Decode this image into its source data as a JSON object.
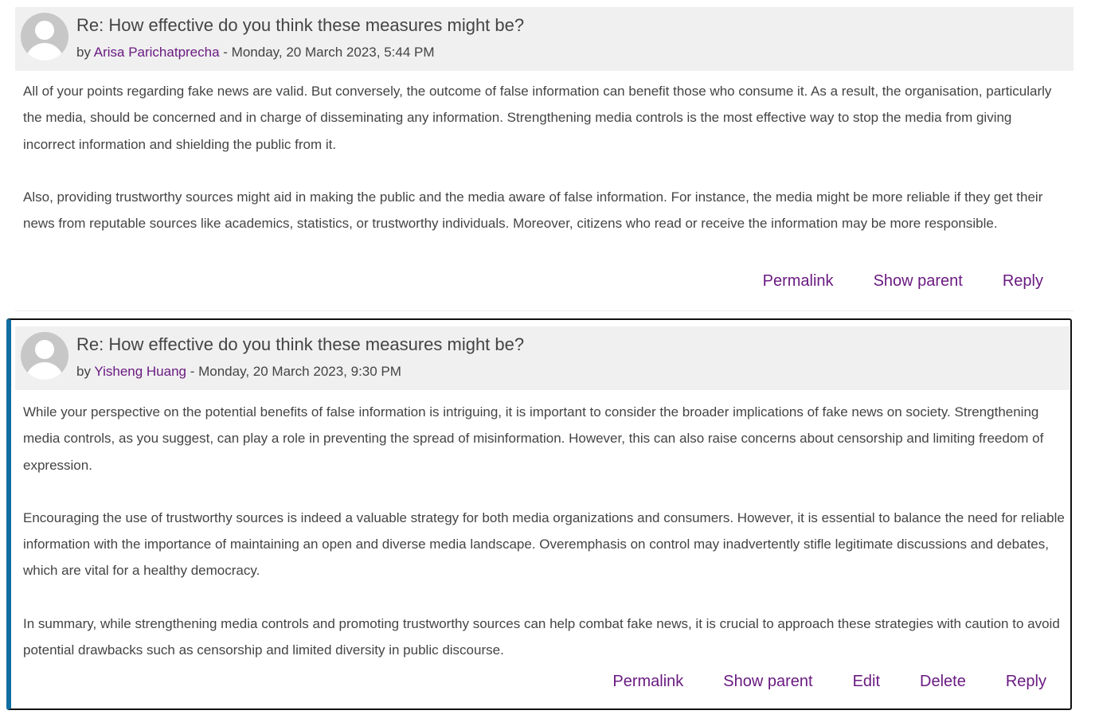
{
  "posts": [
    {
      "subject": "Re: How effective do you think these measures might be?",
      "by_prefix": "by ",
      "author": "Arisa Parichatprecha",
      "date_sep": " - ",
      "date": "Monday, 20 March 2023, 5:44 PM",
      "paragraphs": [
        "All of your points regarding fake news are valid. But conversely, the outcome of false information can benefit those who consume it. As a result, the organisation, particularly the media, should be concerned and in charge of disseminating any information. Strengthening media controls is the most effective way to stop the media from giving incorrect information and shielding the public from it.",
        "Also, providing trustworthy sources might aid in making the public and the media aware of false information. For instance, the media might be more reliable if they get their news from reputable sources like academics, statistics, or trustworthy individuals. Moreover, citizens who read or receive the information may be more responsible."
      ],
      "actions": [
        "Permalink",
        "Show parent",
        "Reply"
      ]
    },
    {
      "subject": "Re: How effective do you think these measures might be?",
      "by_prefix": "by ",
      "author": "Yisheng Huang",
      "date_sep": " - ",
      "date": "Monday, 20 March 2023, 9:30 PM",
      "paragraphs": [
        "While your perspective on the potential benefits of false information is intriguing, it is important to consider the broader implications of fake news on society. Strengthening media controls, as you suggest, can play a role in preventing the spread of misinformation. However, this can also raise concerns about censorship and limiting freedom of expression.",
        "Encouraging the use of trustworthy sources is indeed a valuable strategy for both media organizations and consumers. However, it is essential to balance the need for reliable information with the importance of maintaining an open and diverse media landscape. Overemphasis on control may inadvertently stifle legitimate discussions and debates, which are vital for a healthy democracy.",
        "In summary, while strengthening media controls and promoting trustworthy sources can help combat fake news, it is crucial to approach these strategies with caution to avoid potential drawbacks such as censorship and limited diversity in public discourse."
      ],
      "actions": [
        "Permalink",
        "Show parent",
        "Edit",
        "Delete",
        "Reply"
      ]
    }
  ],
  "colors": {
    "link": "#6a1b81",
    "text": "#444444",
    "header_bg": "#f0f0f0",
    "focus_accent": "#0f6ea1"
  }
}
